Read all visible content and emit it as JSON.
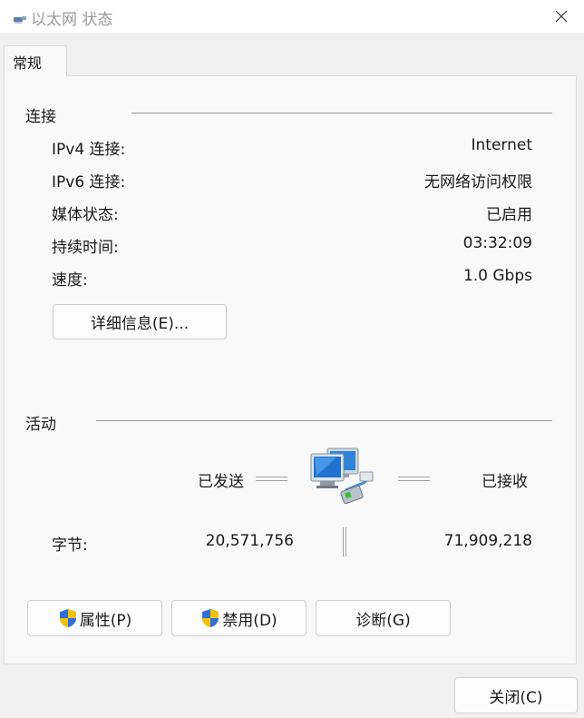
{
  "window": {
    "title": "以太网 状态",
    "icon": "network-adapter-icon"
  },
  "tabs": [
    {
      "label": "常规"
    }
  ],
  "connection": {
    "heading": "连接",
    "rows": [
      {
        "label": "IPv4 连接:",
        "value": "Internet"
      },
      {
        "label": "IPv6 连接:",
        "value": "无网络访问权限"
      },
      {
        "label": "媒体状态:",
        "value": "已启用"
      },
      {
        "label": "持续时间:",
        "value": "03:32:09"
      },
      {
        "label": "速度:",
        "value": "1.0 Gbps"
      }
    ],
    "details_button": "详细信息(E)..."
  },
  "activity": {
    "heading": "活动",
    "sent_label": "已发送",
    "received_label": "已接收",
    "bytes_label": "字节:",
    "bytes_sent": "20,571,756",
    "bytes_received": "71,909,218",
    "icon": "network-computers-icon"
  },
  "buttons": {
    "properties": "属性(P)",
    "disable": "禁用(D)",
    "diagnose": "诊断(G)",
    "close": "关闭(C)"
  },
  "colors": {
    "window_bg": "#f0f0f0",
    "panel_bg": "#f9f9f9",
    "shield_blue": "#2f6fd6",
    "shield_yellow": "#f2c200"
  }
}
